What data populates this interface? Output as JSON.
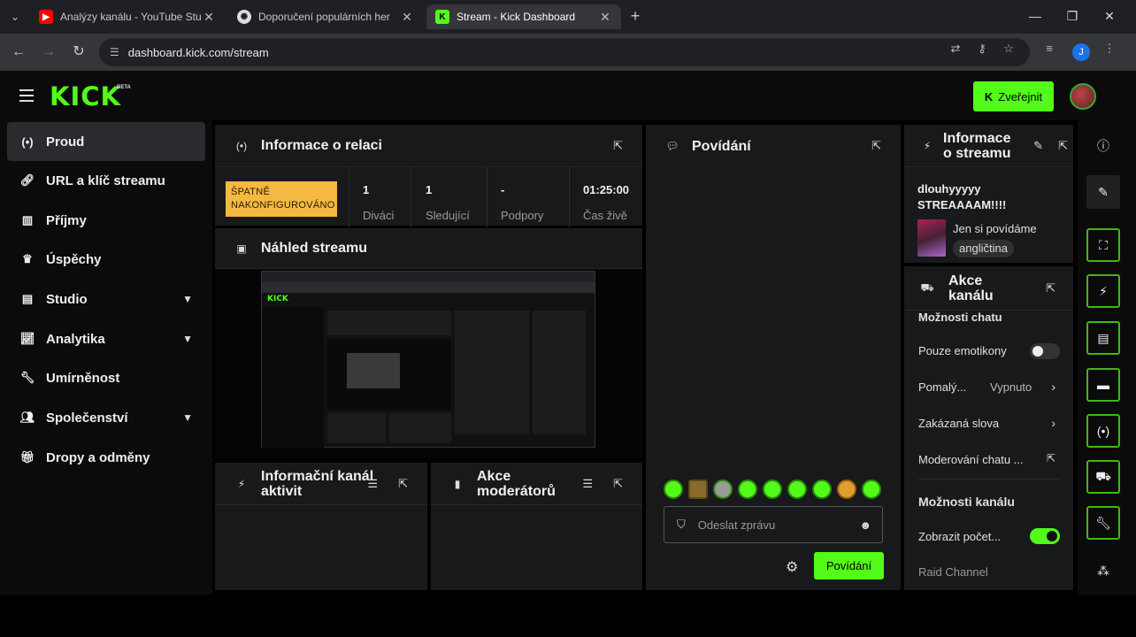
{
  "browser": {
    "tabs": [
      {
        "title": "Analýzy kanálu - YouTube Studio",
        "icon": "youtube-icon"
      },
      {
        "title": "Doporučení populárních her",
        "icon": "chatgpt-icon"
      },
      {
        "title": "Stream - Kick Dashboard",
        "icon": "kick-icon"
      }
    ],
    "url": "dashboard.kick.com/stream",
    "profile_initial": "J"
  },
  "header": {
    "logo": "KICK",
    "beta": "BETA",
    "publish_label": "Zveřejnit"
  },
  "sidebar": {
    "items": [
      {
        "label": "Proud",
        "icon": "broadcast-icon",
        "chevron": false
      },
      {
        "label": "URL a klíč streamu",
        "icon": "link-icon",
        "chevron": false
      },
      {
        "label": "Příjmy",
        "icon": "bar-chart-icon",
        "chevron": false
      },
      {
        "label": "Úspěchy",
        "icon": "trophy-icon",
        "chevron": false
      },
      {
        "label": "Studio",
        "icon": "film-icon",
        "chevron": true
      },
      {
        "label": "Analytika",
        "icon": "analytics-icon",
        "chevron": true
      },
      {
        "label": "Umírněnost",
        "icon": "wrench-icon",
        "chevron": false
      },
      {
        "label": "Společenství",
        "icon": "community-icon",
        "chevron": true
      },
      {
        "label": "Dropy a odměny",
        "icon": "gift-icon",
        "chevron": false
      }
    ]
  },
  "session": {
    "title": "Informace o relaci",
    "badge": "ŠPATNĚ NAKONFIGUROVÁNO",
    "stats": [
      {
        "value": "1",
        "label": "Diváci"
      },
      {
        "value": "1",
        "label": "Sledující"
      },
      {
        "value": "-",
        "label": "Podpory"
      },
      {
        "value": "01:25:00",
        "label": "Čas živě"
      }
    ]
  },
  "preview": {
    "title": "Náhled streamu"
  },
  "activity": {
    "title": "Informační kanál aktivit"
  },
  "modactions": {
    "title": "Akce moderátorů"
  },
  "chat": {
    "title": "Povídání",
    "placeholder": "Odeslat zprávu",
    "send_label": "Povídání"
  },
  "streaminfo": {
    "title": "Informace o streamu",
    "stream_title": "dlouhyyyyy STREAAAAM!!!!",
    "category": "Jen si povídáme",
    "tag": "angličtina"
  },
  "channelactions": {
    "title": "Akce kanálu",
    "chat_section": "Možnosti chatu",
    "emotes_only": "Pouze emotikony",
    "emotes_only_on": false,
    "slow_mode": "Pomalý...",
    "slow_mode_value": "Vypnuto",
    "banned_words": "Zakázaná slova",
    "chat_moderation": "Moderování chatu ...",
    "channel_section": "Možnosti kanálu",
    "show_count": "Zobrazit počet...",
    "show_count_on": true,
    "raid": "Raid Channel"
  },
  "colors": {
    "accent": "#53fc18",
    "warning": "#f4b942",
    "panel": "#18191b"
  }
}
